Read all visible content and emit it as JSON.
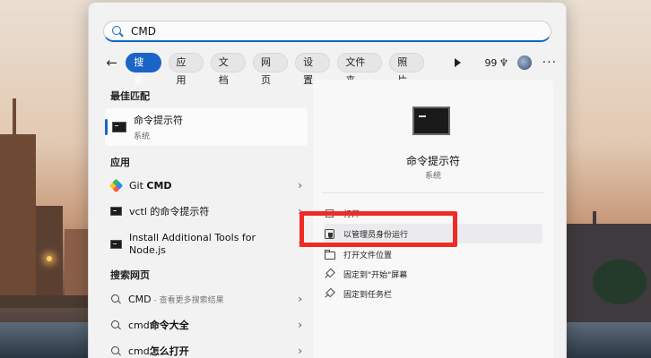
{
  "search": {
    "value": "CMD",
    "placeholder": ""
  },
  "tabs": [
    {
      "label": "搜索",
      "active": true
    },
    {
      "label": "应用"
    },
    {
      "label": "文档"
    },
    {
      "label": "网页"
    },
    {
      "label": "设置"
    },
    {
      "label": "文件夹"
    },
    {
      "label": "照片"
    }
  ],
  "toolbar": {
    "points": "99"
  },
  "left": {
    "best_match_title": "最佳匹配",
    "best_match": {
      "name": "命令提示符",
      "sub": "系统"
    },
    "apps_title": "应用",
    "apps": [
      {
        "pre": "Git ",
        "bold": "CMD"
      },
      {
        "pre": "vctl 的命令提示符",
        "bold": ""
      },
      {
        "line1": "Install Additional Tools for",
        "line2": "Node.js"
      }
    ],
    "web_title": "搜索网页",
    "web": [
      {
        "pre": "CMD",
        "suffix": " - 查看更多搜索结果"
      },
      {
        "pre": "cmd",
        "bold": "命令大全"
      },
      {
        "pre": "cmd",
        "bold": "怎么打开"
      }
    ]
  },
  "preview": {
    "title": "命令提示符",
    "sub": "系统",
    "actions": [
      {
        "label": "打开"
      },
      {
        "label": "以管理员身份运行"
      },
      {
        "label": "打开文件位置"
      },
      {
        "label": "固定到\"开始\"屏幕"
      },
      {
        "label": "固定到任务栏"
      }
    ]
  },
  "colors": {
    "accent": "#1a64c8",
    "highlight": "#ef2b24"
  }
}
